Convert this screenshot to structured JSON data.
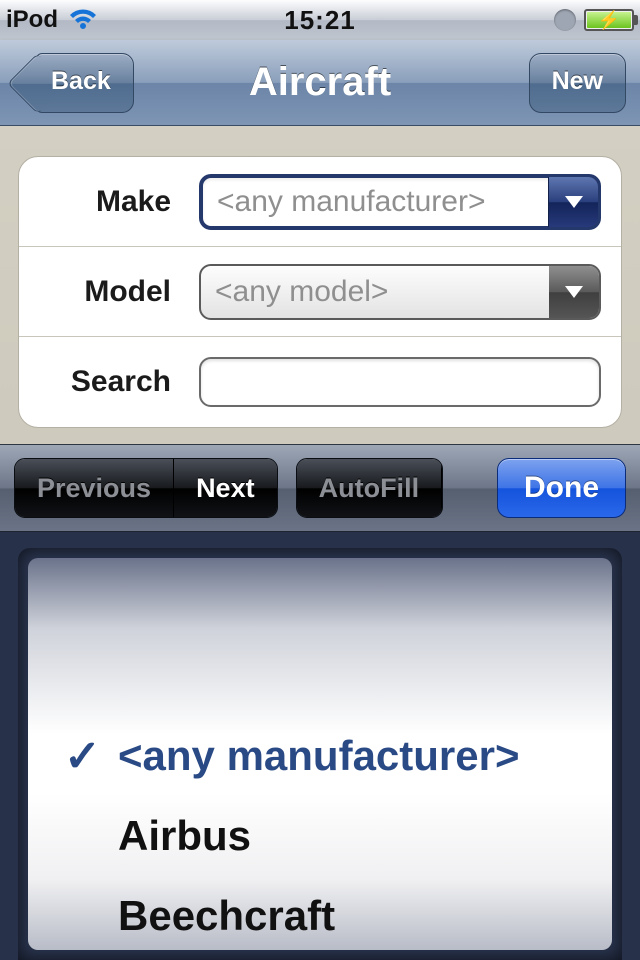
{
  "status": {
    "carrier": "iPod",
    "time": "15:21"
  },
  "nav": {
    "title": "Aircraft",
    "back": "Back",
    "new": "New"
  },
  "form": {
    "make": {
      "label": "Make",
      "value": "<any manufacturer>"
    },
    "model": {
      "label": "Model",
      "value": "<any model>"
    },
    "search": {
      "label": "Search",
      "value": ""
    }
  },
  "assist": {
    "prev": "Previous",
    "next": "Next",
    "autofill": "AutoFill",
    "done": "Done"
  },
  "picker": {
    "options": [
      "<any manufacturer>",
      "Airbus",
      "Beechcraft"
    ],
    "selected_index": 0
  }
}
